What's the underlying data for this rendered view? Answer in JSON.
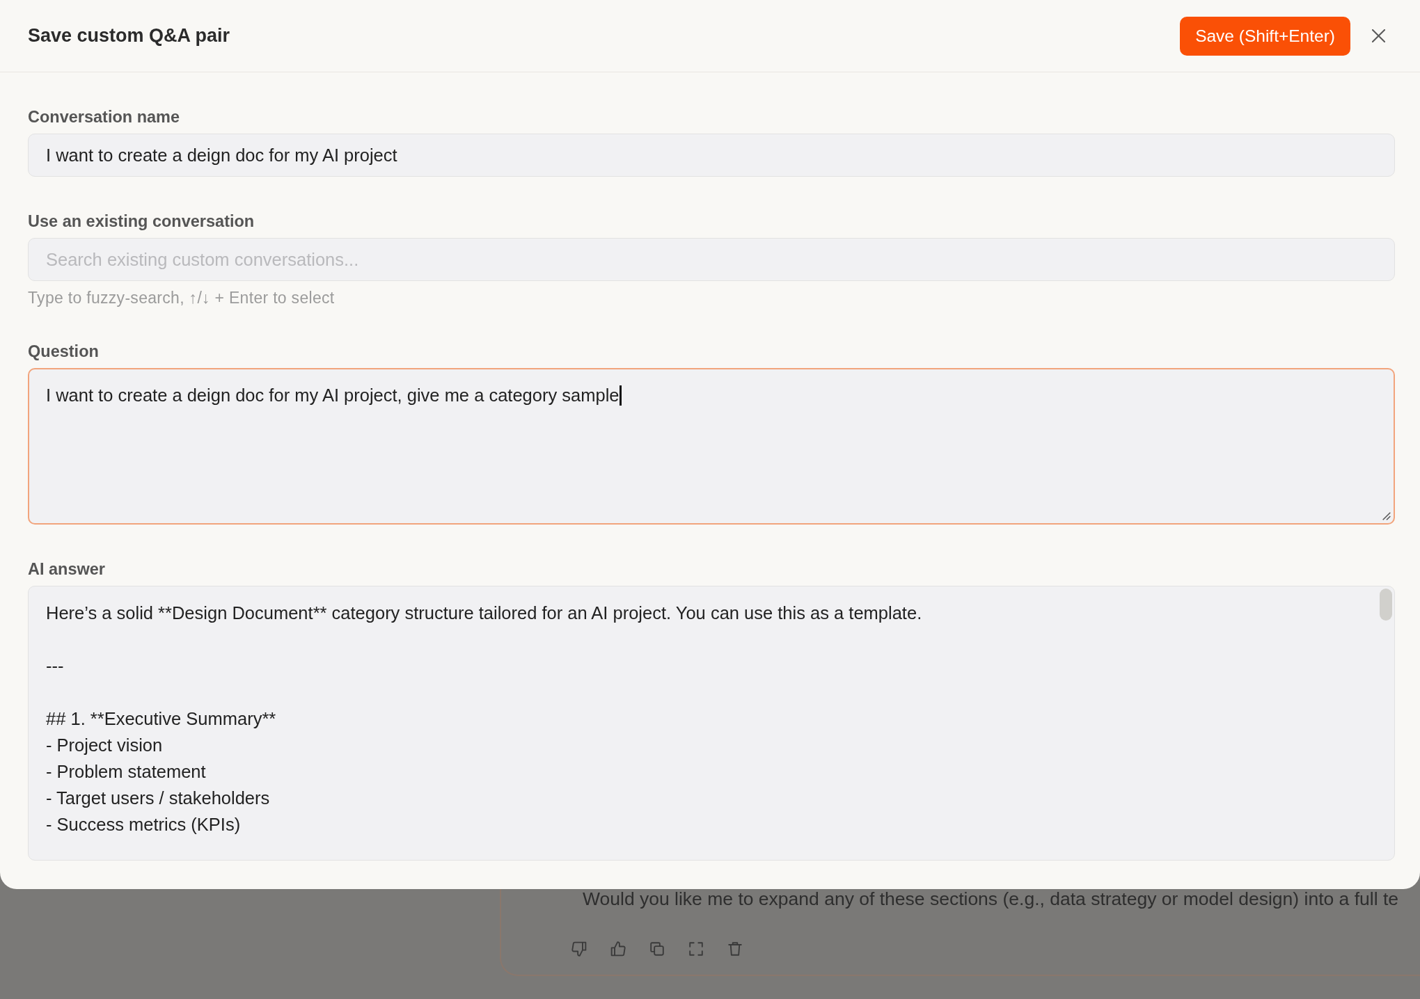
{
  "dialog": {
    "title": "Save custom Q&A pair",
    "save_button": "Save (Shift+Enter)"
  },
  "fields": [
    {
      "kind": "text",
      "label": "Conversation name",
      "value": "I want to create a deign doc for my AI project",
      "focused": false
    },
    {
      "kind": "search",
      "label": "Use an existing conversation",
      "placeholder": "Search existing custom conversations...",
      "hint": "Type to fuzzy-search, ↑/↓ + Enter to select",
      "focused": false
    },
    {
      "kind": "textarea",
      "label": "Question",
      "value": "I want to create a deign doc for my AI project, give me a category sample",
      "focused": true
    },
    {
      "kind": "longtext",
      "label": "AI answer",
      "value": "Here’s a solid **Design Document** category structure tailored for an AI project. You can use this as a template.\n\n---\n\n## 1. **Executive Summary**\n- Project vision\n- Problem statement\n- Target users / stakeholders\n- Success metrics (KPIs)",
      "focused": false
    }
  ],
  "background_message": {
    "text": "Would you like me to expand any of these sections (e.g., data strategy or model design) into a full te"
  }
}
